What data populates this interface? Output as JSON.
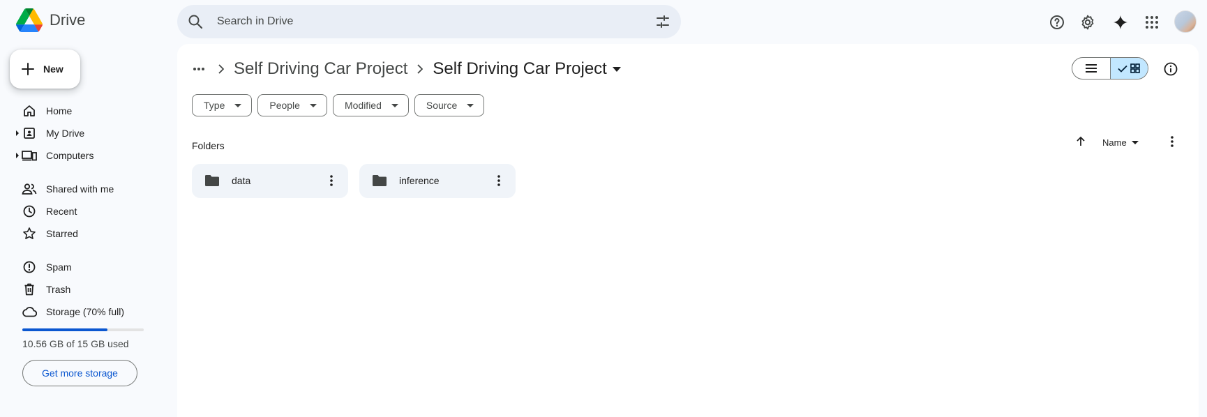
{
  "app": {
    "name": "Drive",
    "logo_icon": "google-drive-logo"
  },
  "search": {
    "placeholder": "Search in Drive"
  },
  "top_actions": [
    "help-icon",
    "settings-icon",
    "gemini-sparkle-icon",
    "apps-grid-icon",
    "account-avatar"
  ],
  "sidebar": {
    "new_label": "New",
    "items": [
      {
        "label": "Home",
        "icon": "home-icon"
      },
      {
        "label": "My Drive",
        "icon": "my-drive-icon",
        "expandable": true
      },
      {
        "label": "Computers",
        "icon": "computers-icon",
        "expandable": true
      },
      {
        "label": "Shared with me",
        "icon": "shared-icon"
      },
      {
        "label": "Recent",
        "icon": "clock-icon"
      },
      {
        "label": "Starred",
        "icon": "star-icon"
      },
      {
        "label": "Spam",
        "icon": "spam-icon"
      },
      {
        "label": "Trash",
        "icon": "trash-icon"
      },
      {
        "label": "Storage (70% full)",
        "icon": "cloud-icon"
      }
    ],
    "storage": {
      "used_fraction": 0.7,
      "text": "10.56 GB of 15 GB used",
      "button_label": "Get more storage"
    }
  },
  "breadcrumb": {
    "parent": "Self Driving Car Project",
    "current": "Self Driving Car Project"
  },
  "view": {
    "mode": "grid"
  },
  "filters": [
    {
      "label": "Type"
    },
    {
      "label": "People"
    },
    {
      "label": "Modified"
    },
    {
      "label": "Source"
    }
  ],
  "content": {
    "section_title": "Folders",
    "sort_label": "Name",
    "folders": [
      {
        "name": "data"
      },
      {
        "name": "inference"
      }
    ]
  },
  "colors": {
    "accent": "#0b57d0",
    "selected_view": "#c2e7ff",
    "background": "#f8fafd"
  }
}
